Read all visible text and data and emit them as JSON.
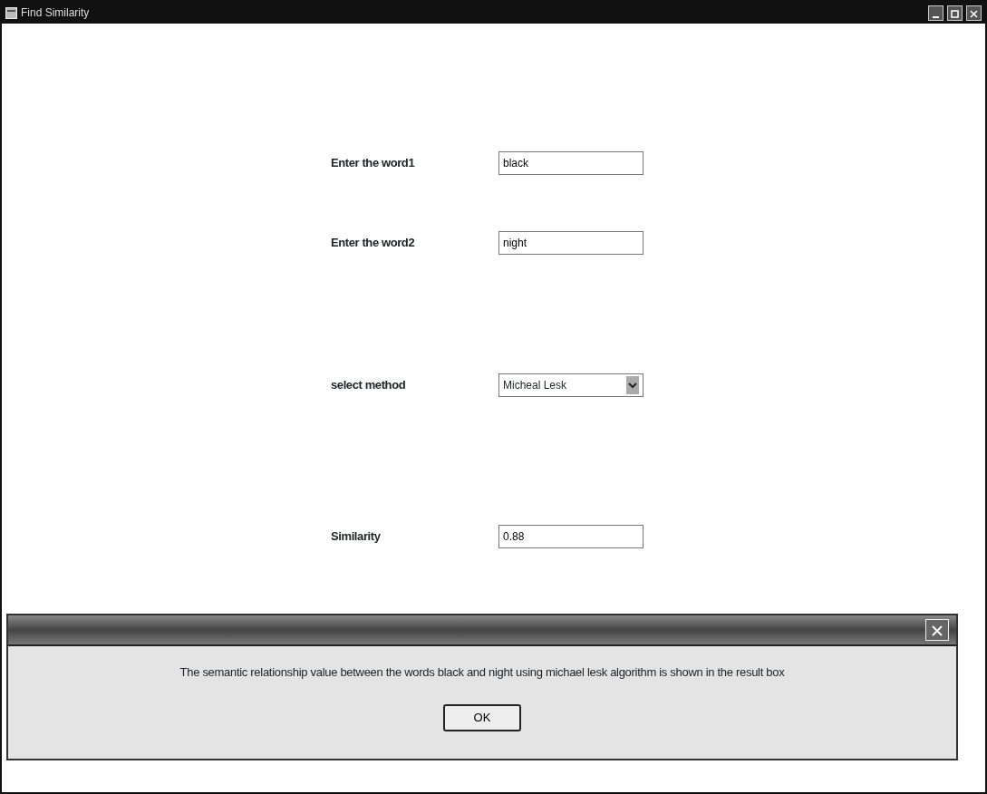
{
  "window": {
    "title": "Find Similarity"
  },
  "fields": [
    {
      "kind": "text",
      "label": "Enter the word1",
      "value": "black"
    },
    {
      "kind": "text",
      "label": "Enter the word2",
      "value": "night"
    },
    {
      "kind": "select",
      "label": "select method",
      "value": "Micheal Lesk"
    },
    {
      "kind": "text",
      "label": "Similarity",
      "value": "0.88"
    }
  ],
  "dialog": {
    "message": "The semantic relationship value between the words black and night using michael lesk algorithm is shown in the result box",
    "button": "OK"
  }
}
